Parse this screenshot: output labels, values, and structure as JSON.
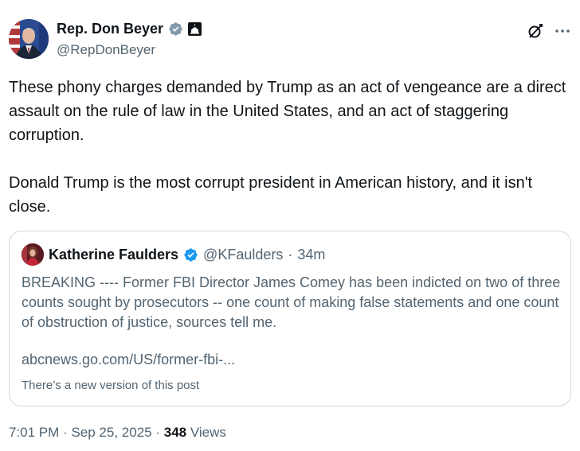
{
  "author": {
    "display_name": "Rep. Don Beyer",
    "handle": "@RepDonBeyer",
    "verified_color": "#829aab",
    "affiliation_icon": "capitol-building-icon"
  },
  "tweet": {
    "text": "These phony charges demanded by Trump as an act of vengeance are a direct assault on the rule of law in the United States, and an act of staggering corruption.\n\nDonald Trump is the most corrupt president in American history, and it isn't close."
  },
  "quote": {
    "display_name": "Katherine Faulders",
    "verified_color": "#1d9bf0",
    "handle": "@KFaulders",
    "separator": "·",
    "time": "34m",
    "text": "BREAKING ---- Former FBI Director James Comey has been indicted on two of three counts sought by prosecutors -- one count of making false statements and one count of obstruction of justice, sources tell me.",
    "link": "abcnews.go.com/US/former-fbi-...",
    "notice": "There’s a new version of this post"
  },
  "footer": {
    "time": "7:01 PM",
    "sep1": "·",
    "date": "Sep 25, 2025",
    "sep2": "·",
    "views_count": "348",
    "views_label": "Views"
  }
}
